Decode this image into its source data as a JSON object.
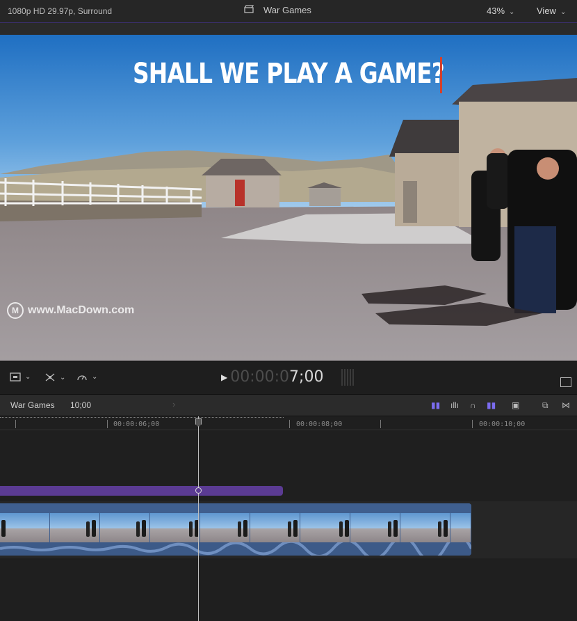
{
  "viewer": {
    "format": "1080p HD 29.97p, Surround",
    "project_title": "War Games",
    "zoom": "43%",
    "view_menu": "View",
    "overlay_title": "SHALL WE PLAY A GAME?",
    "watermark": "www.MacDown.com"
  },
  "toolbar": {
    "timecode_dim": "00:00:0",
    "timecode_bright": "7;00"
  },
  "timeline": {
    "project_name": "War Games",
    "duration": "10;00",
    "ruler": [
      "00:00:06;00",
      "00:00:08;00",
      "00:00:10;00"
    ]
  },
  "colors": {
    "accent": "#5b3b93",
    "clip": "#4a6fa6",
    "cursor": "#d5402b",
    "index_icon": "#7b6cf0"
  }
}
